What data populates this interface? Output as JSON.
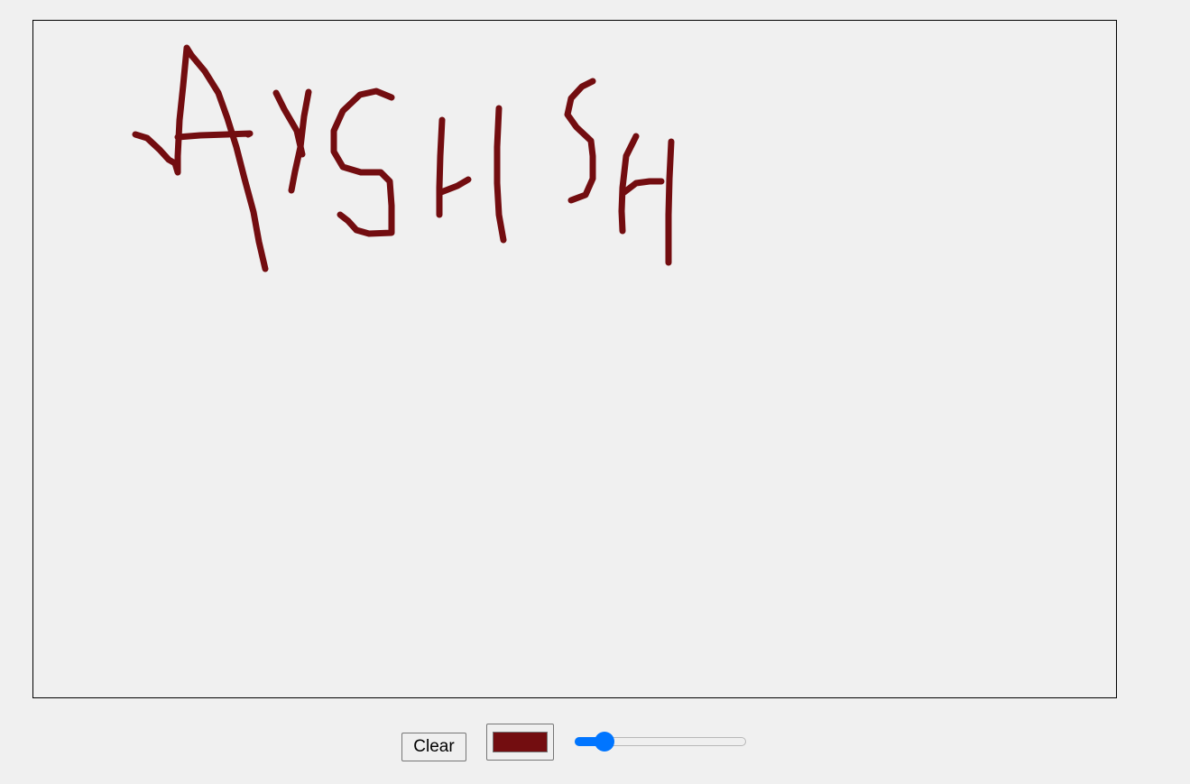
{
  "toolbar": {
    "clear_label": "Clear",
    "color_value": "#730d10",
    "brush_size_fraction": 0.13
  },
  "drawing": {
    "stroke_color": "#730d10",
    "handwritten_text": "AYSHISH"
  }
}
